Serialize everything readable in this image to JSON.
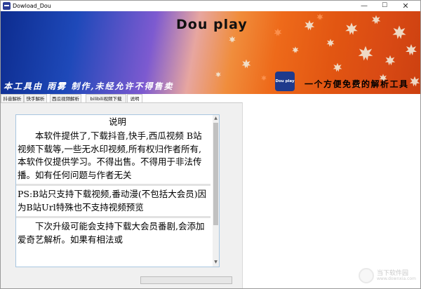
{
  "window": {
    "title": "Dowload_Dou",
    "minimize": "—",
    "maximize": "☐",
    "close": "✕"
  },
  "banner": {
    "title": "Dou play",
    "slogan_left": "本工具由 雨雾 制作,未经允许不得售卖",
    "logo_text": "Dou play",
    "slogan_right": "一个方便免费的解析工具"
  },
  "tabs": [
    {
      "label": "抖音解析"
    },
    {
      "label": "快手解析"
    },
    {
      "label": "西瓜视频解析"
    },
    {
      "label": "bilibili视频下载"
    },
    {
      "label": "说明",
      "active": true
    }
  ],
  "content": {
    "heading": "说明",
    "paragraph1": "本软件提供了,下载抖音,快手,西瓜视频 B站视频下载等,一些无水印视频,所有权归作者所有,本软件仅提供学习。不得出售。不得用于非法传播。如有任何问题与作者无关",
    "paragraph2": "PS:B站只支持下载视频,番动漫(不包括大会员)因为B站Url特殊也不支持视频预览",
    "paragraph3": "下次升级可能会支持下载大会员番剧,会添加爱奇艺解析。如果有相法或"
  },
  "scrollbar": {
    "up": "▲",
    "down": "▼"
  },
  "watermark": {
    "text": "当下软件园",
    "url": "www.downxia.com"
  }
}
